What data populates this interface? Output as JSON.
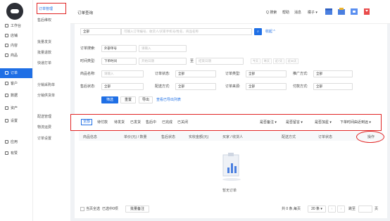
{
  "sidebar": {
    "items": [
      {
        "label": "工作台"
      },
      {
        "label": "店铺"
      },
      {
        "label": "内容"
      },
      {
        "label": "商品"
      },
      {
        "label": "订单"
      },
      {
        "label": "客户"
      },
      {
        "label": "数据"
      },
      {
        "label": "资产"
      },
      {
        "label": "设置"
      },
      {
        "label": "应用"
      },
      {
        "label": "有赞"
      }
    ]
  },
  "subnav": {
    "items": [
      {
        "label": "订单管理"
      },
      {
        "label": "售后维权"
      },
      {
        "label": "批量发货"
      },
      {
        "label": "批量退款"
      },
      {
        "label": "快递打单"
      },
      {
        "label": "分销采购单"
      },
      {
        "label": "分销供货单"
      },
      {
        "label": "配送管理"
      },
      {
        "label": "物流运费"
      },
      {
        "label": "订单设置"
      }
    ]
  },
  "header": {
    "title": "订单查询",
    "search": "Q 搜索",
    "help": "帮助",
    "message": "消息",
    "user": "檬子 ▾"
  },
  "filters": {
    "store": "全部",
    "keyword_placeholder": "可输入订单编号、收货人/买家手机号/姓名、商品名称",
    "collapse": "收起 ^",
    "order_search_label": "订单搜索:",
    "order_search_type": "外部单号",
    "order_search_placeholder": "请输入",
    "time_type_label": "时间类型:",
    "time_type": "下单时间",
    "start_placeholder": "开始日期",
    "to": "至",
    "end_placeholder": "结束日期",
    "quick_dates": [
      "今天",
      "昨天",
      "近7天",
      "近30天"
    ],
    "product_label": "商品名称:",
    "product_placeholder": "请输入",
    "order_status_label": "订单状态:",
    "order_status": "全部",
    "order_type_label": "订单类型:",
    "order_type": "全部",
    "promo_label": "推广方式:",
    "promo": "全部",
    "refund_label": "售后状态:",
    "refund": "全部",
    "delivery_label": "配送方式:",
    "delivery": "全部",
    "source_label": "订单来源:",
    "source": "全部",
    "pay_label": "付款方式:",
    "pay": "全部",
    "filter_btn": "筛选",
    "reset_btn": "重置",
    "export_btn": "导出",
    "export_list": "查看已导出列表"
  },
  "tabs": [
    "全部",
    "待付款",
    "待发货",
    "已发货",
    "售后中",
    "已完成",
    "已关闭"
  ],
  "tab_dropdowns": [
    "是否备注 ▾",
    "是否留言 ▾",
    "是否加星 ▾",
    "下单时间由近到远 ▾"
  ],
  "table": {
    "columns": [
      "商品信息",
      "单价(元) / 数量",
      "售后状态",
      "实收金额(元)",
      "买家 / 收货人",
      "配送方式",
      "订单状态",
      "操作"
    ],
    "empty": "暂无订单"
  },
  "footer": {
    "select_page": "当页全选",
    "selected": "已选中0项",
    "batch_note": "批量备注",
    "total": "共 0 条,每页",
    "per_page": "20 条 ▾",
    "goto": "跳至",
    "page": "页"
  },
  "colors": {
    "accent": "#1f6fe5",
    "highlight": "#e02424"
  }
}
